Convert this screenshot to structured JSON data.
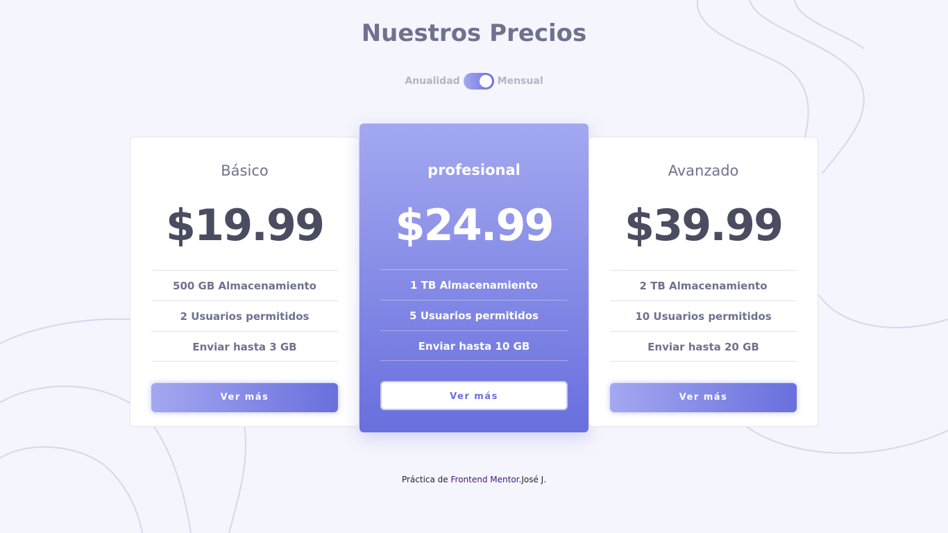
{
  "header": {
    "title": "Nuestros Precios"
  },
  "billing_toggle": {
    "left_label": "Anualidad",
    "right_label": "Mensual",
    "selected": "Mensual"
  },
  "plans": [
    {
      "name": "Básico",
      "price": "$19.99",
      "features": [
        "500 GB Almacenamiento",
        "2 Usuarios permitidos",
        "Enviar hasta 3 GB"
      ],
      "button_label": "Ver más"
    },
    {
      "name": "profesional",
      "price": "$24.99",
      "features": [
        "1 TB Almacenamiento",
        "5 Usuarios permitidos",
        "Enviar hasta 10 GB"
      ],
      "button_label": "Ver más"
    },
    {
      "name": "Avanzado",
      "price": "$39.99",
      "features": [
        "2 TB Almacenamiento",
        "10 Usuarios permitidos",
        "Enviar hasta 20 GB"
      ],
      "button_label": "Ver más"
    }
  ],
  "footer": {
    "prefix": "Práctica de",
    "link": "Frontend Mentor",
    "author": ".José J."
  },
  "colors": {
    "background": "#f5f5fd",
    "accent_light": "#a3a8f0",
    "accent_dark": "#696fdd",
    "text_dark": "#4a4d60",
    "text_muted": "#6e728e",
    "link": "#3e1a7a"
  }
}
